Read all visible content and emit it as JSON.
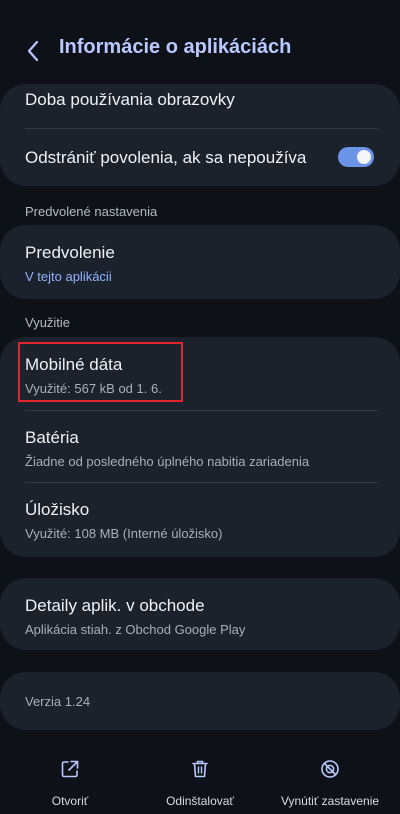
{
  "header": {
    "back_icon": "chevron-left-icon",
    "title": "Informácie o aplikáciách"
  },
  "top_card": {
    "screen_time_label": "Doba používania obrazovky",
    "remove_permissions_label": "Odstrániť povolenia, ak sa nepoužíva",
    "remove_permissions_enabled": true
  },
  "defaults_section": {
    "label": "Predvolené nastavenia",
    "default_title": "Predvolenie",
    "default_sub": "V tejto aplikácii"
  },
  "usage_section": {
    "label": "Využitie",
    "items": [
      {
        "title": "Mobilné dáta",
        "sub": "Využité: 567 kB od 1. 6."
      },
      {
        "title": "Batéria",
        "sub": "Žiadne od posledného úplného nabitia zariadenia"
      },
      {
        "title": "Úložisko",
        "sub": "Využité: 108 MB (Interné úložisko)"
      }
    ]
  },
  "store_card": {
    "title": "Detaily aplik. v obchode",
    "sub": "Aplikácia stiah. z Obchod Google Play"
  },
  "version_card": {
    "label": "Verzia 1.24"
  },
  "bottom_actions": [
    {
      "label": "Otvoriť",
      "icon": "open-external-icon"
    },
    {
      "label": "Odinštalovať",
      "icon": "trash-icon"
    },
    {
      "label": "Vynútiť zastavenie",
      "icon": "force-stop-icon"
    }
  ],
  "colors": {
    "background": "#0e1117",
    "card": "#1c222c",
    "title_accent": "#b7c9ff",
    "link_accent": "#8fb1ff",
    "toggle_on": "#6b93e6",
    "highlight_box": "#e2252a"
  }
}
